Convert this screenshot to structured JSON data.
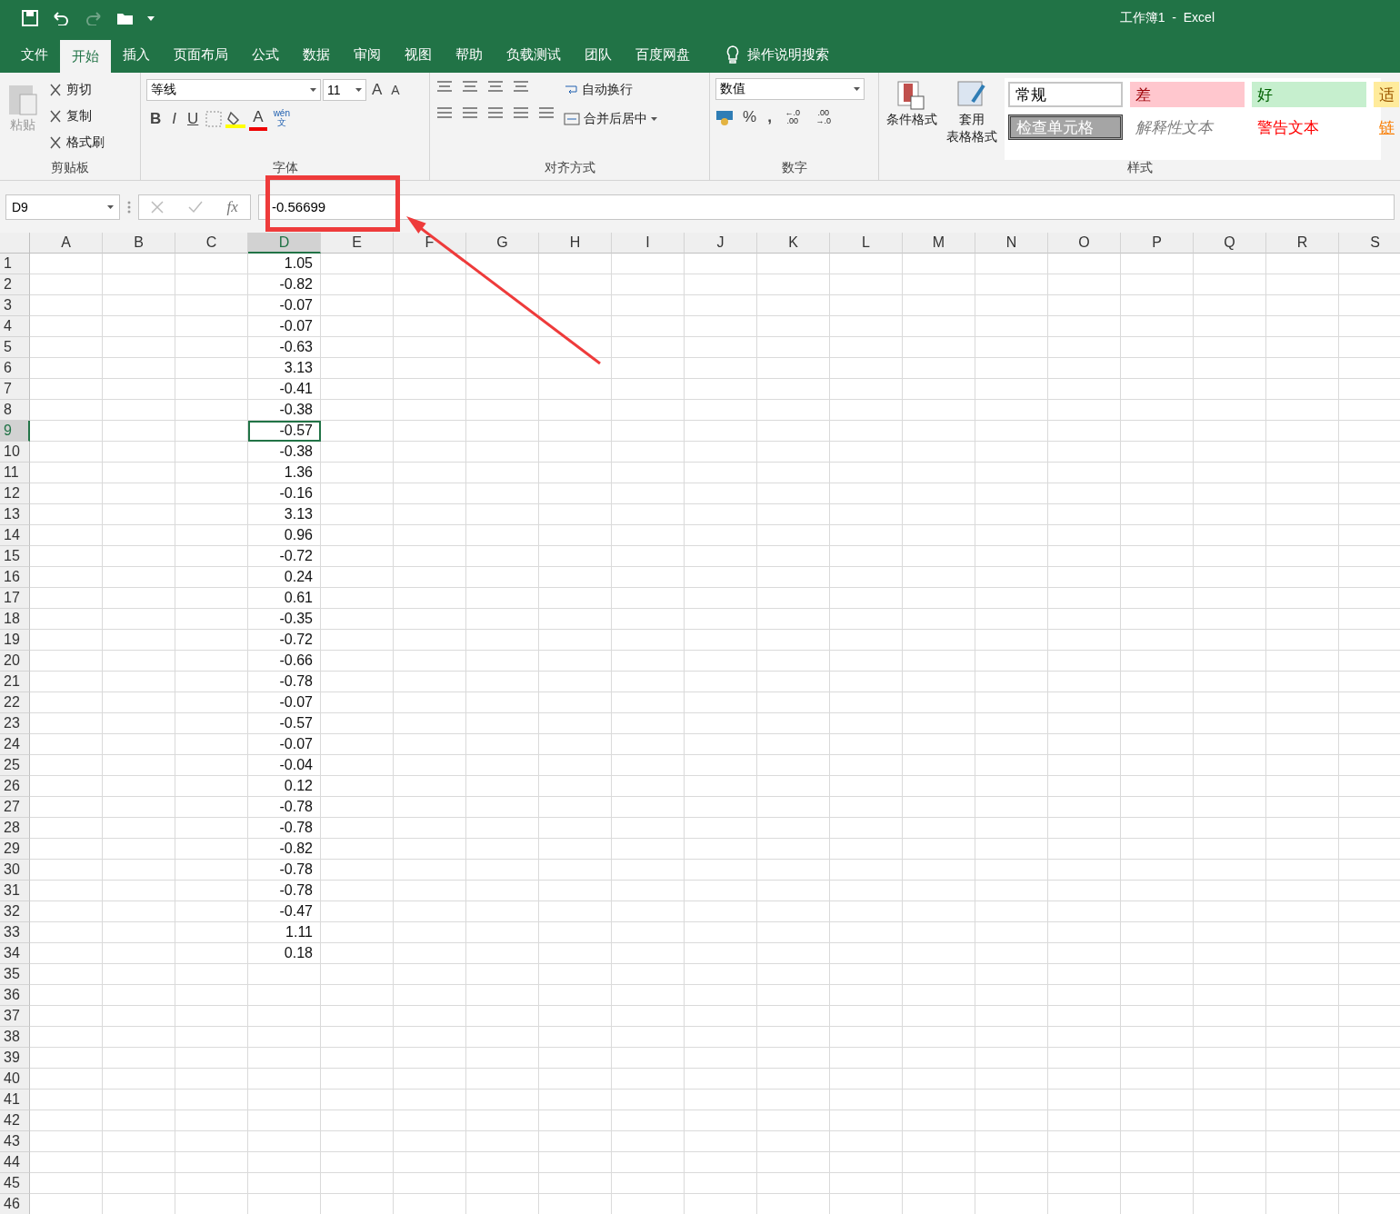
{
  "title": "工作簿1  -  Excel",
  "tabs": [
    {
      "label": "文件",
      "selected": false
    },
    {
      "label": "开始",
      "selected": true
    },
    {
      "label": "插入",
      "selected": false
    },
    {
      "label": "页面布局",
      "selected": false
    },
    {
      "label": "公式",
      "selected": false
    },
    {
      "label": "数据",
      "selected": false
    },
    {
      "label": "审阅",
      "selected": false
    },
    {
      "label": "视图",
      "selected": false
    },
    {
      "label": "帮助",
      "selected": false
    },
    {
      "label": "负载测试",
      "selected": false
    },
    {
      "label": "团队",
      "selected": false
    },
    {
      "label": "百度网盘",
      "selected": false
    }
  ],
  "tell_me": "操作说明搜索",
  "clipboard": {
    "label": "剪贴板",
    "paste": "粘贴",
    "items": [
      "剪切",
      "复制",
      "格式刷"
    ]
  },
  "font": {
    "label": "字体",
    "name": "等线",
    "size": "11",
    "grow": "A",
    "shrink": "A",
    "bold": "B",
    "italic": "I",
    "underline": "U",
    "font_color_glyph": "A",
    "phonetic_top": "wén",
    "phonetic": "文"
  },
  "alignment": {
    "label": "对齐方式",
    "wrap": "自动换行",
    "merge": "合并后居中"
  },
  "number": {
    "label": "数字",
    "format": "数值",
    "percent": "%",
    "comma": ",",
    "inc": "←.0 .00",
    "dec": ".00 →.0"
  },
  "styles": {
    "label": "样式",
    "conditional": "条件格式",
    "table_top": "套用",
    "table_bottom": "表格格式",
    "cells": [
      {
        "label": "常规",
        "kind": "normal"
      },
      {
        "label": "差",
        "kind": "bad"
      },
      {
        "label": "好",
        "kind": "good"
      },
      {
        "label": "适",
        "kind": "neutral"
      },
      {
        "label": "检查单元格",
        "kind": "check"
      },
      {
        "label": "解释性文本",
        "kind": "explanatory"
      },
      {
        "label": "警告文本",
        "kind": "warning"
      },
      {
        "label": "链",
        "kind": "link"
      }
    ]
  },
  "name_box": "D9",
  "fx": "fx",
  "formula": "-0.56699",
  "columns": [
    {
      "label": "A",
      "selected": false
    },
    {
      "label": "B",
      "selected": false
    },
    {
      "label": "C",
      "selected": false
    },
    {
      "label": "D",
      "selected": true
    },
    {
      "label": "E",
      "selected": false
    },
    {
      "label": "F",
      "selected": false
    },
    {
      "label": "G",
      "selected": false
    },
    {
      "label": "H",
      "selected": false
    },
    {
      "label": "I",
      "selected": false
    },
    {
      "label": "J",
      "selected": false
    },
    {
      "label": "K",
      "selected": false
    },
    {
      "label": "L",
      "selected": false
    },
    {
      "label": "M",
      "selected": false
    },
    {
      "label": "N",
      "selected": false
    },
    {
      "label": "O",
      "selected": false
    },
    {
      "label": "P",
      "selected": false
    },
    {
      "label": "Q",
      "selected": false
    },
    {
      "label": "R",
      "selected": false
    },
    {
      "label": "S",
      "selected": false
    }
  ],
  "rows": [
    {
      "label": "1",
      "value": "1.05",
      "selected": false
    },
    {
      "label": "2",
      "value": "-0.82",
      "selected": false
    },
    {
      "label": "3",
      "value": "-0.07",
      "selected": false
    },
    {
      "label": "4",
      "value": "-0.07",
      "selected": false
    },
    {
      "label": "5",
      "value": "-0.63",
      "selected": false
    },
    {
      "label": "6",
      "value": "3.13",
      "selected": false
    },
    {
      "label": "7",
      "value": "-0.41",
      "selected": false
    },
    {
      "label": "8",
      "value": "-0.38",
      "selected": false
    },
    {
      "label": "9",
      "value": "-0.57",
      "selected": true
    },
    {
      "label": "10",
      "value": "-0.38",
      "selected": false
    },
    {
      "label": "11",
      "value": "1.36",
      "selected": false
    },
    {
      "label": "12",
      "value": "-0.16",
      "selected": false
    },
    {
      "label": "13",
      "value": "3.13",
      "selected": false
    },
    {
      "label": "14",
      "value": "0.96",
      "selected": false
    },
    {
      "label": "15",
      "value": "-0.72",
      "selected": false
    },
    {
      "label": "16",
      "value": "0.24",
      "selected": false
    },
    {
      "label": "17",
      "value": "0.61",
      "selected": false
    },
    {
      "label": "18",
      "value": "-0.35",
      "selected": false
    },
    {
      "label": "19",
      "value": "-0.72",
      "selected": false
    },
    {
      "label": "20",
      "value": "-0.66",
      "selected": false
    },
    {
      "label": "21",
      "value": "-0.78",
      "selected": false
    },
    {
      "label": "22",
      "value": "-0.07",
      "selected": false
    },
    {
      "label": "23",
      "value": "-0.57",
      "selected": false
    },
    {
      "label": "24",
      "value": "-0.07",
      "selected": false
    },
    {
      "label": "25",
      "value": "-0.04",
      "selected": false
    },
    {
      "label": "26",
      "value": "0.12",
      "selected": false
    },
    {
      "label": "27",
      "value": "-0.78",
      "selected": false
    },
    {
      "label": "28",
      "value": "-0.78",
      "selected": false
    },
    {
      "label": "29",
      "value": "-0.82",
      "selected": false
    },
    {
      "label": "30",
      "value": "-0.78",
      "selected": false
    },
    {
      "label": "31",
      "value": "-0.78",
      "selected": false
    },
    {
      "label": "32",
      "value": "-0.47",
      "selected": false
    },
    {
      "label": "33",
      "value": "1.11",
      "selected": false
    },
    {
      "label": "34",
      "value": "0.18",
      "selected": false
    },
    {
      "label": "35",
      "selected": false
    },
    {
      "label": "36",
      "selected": false
    },
    {
      "label": "37",
      "selected": false
    },
    {
      "label": "38",
      "selected": false
    },
    {
      "label": "39",
      "selected": false
    },
    {
      "label": "40",
      "selected": false
    },
    {
      "label": "41",
      "selected": false
    },
    {
      "label": "42",
      "selected": false
    },
    {
      "label": "43",
      "selected": false
    },
    {
      "label": "44",
      "selected": false
    },
    {
      "label": "45",
      "selected": false
    },
    {
      "label": "46",
      "selected": false
    }
  ]
}
